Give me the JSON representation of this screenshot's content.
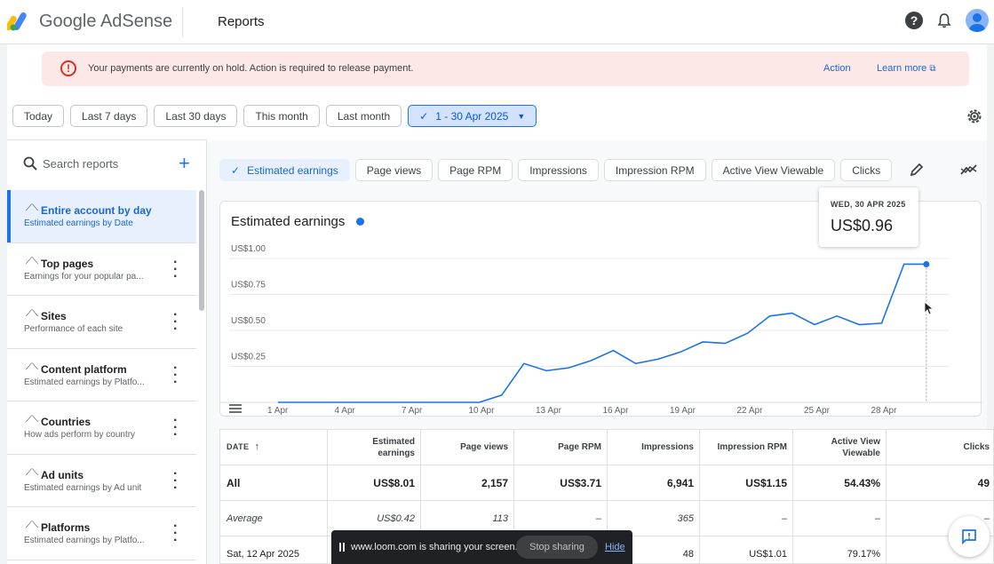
{
  "header": {
    "brand": "Google AdSense",
    "title": "Reports",
    "icons": [
      "help-icon",
      "notifications-icon",
      "account-avatar"
    ]
  },
  "alert": {
    "message": "Your payments are currently on hold. Action is required to release payment.",
    "action_label": "Action",
    "learn_more_label": "Learn more"
  },
  "date_ranges": [
    {
      "label": "Today"
    },
    {
      "label": "Last 7 days"
    },
    {
      "label": "Last 30 days"
    },
    {
      "label": "This month"
    },
    {
      "label": "Last month"
    },
    {
      "label": "1 - 30 Apr 2025",
      "selected": true
    }
  ],
  "sidebar": {
    "search_placeholder": "Search reports",
    "reports": [
      {
        "title": "Entire account by day",
        "subtitle": "Estimated earnings by Date",
        "active": true
      },
      {
        "title": "Top pages",
        "subtitle": "Earnings for your popular pa..."
      },
      {
        "title": "Sites",
        "subtitle": "Performance of each site"
      },
      {
        "title": "Content platform",
        "subtitle": "Estimated earnings by Platfo..."
      },
      {
        "title": "Countries",
        "subtitle": "How ads perform by country"
      },
      {
        "title": "Ad units",
        "subtitle": "Estimated earnings by Ad unit"
      },
      {
        "title": "Platforms",
        "subtitle": "Estimated earnings by Platfo..."
      }
    ]
  },
  "metrics": [
    {
      "label": "Estimated earnings",
      "selected": true
    },
    {
      "label": "Page views"
    },
    {
      "label": "Page RPM"
    },
    {
      "label": "Impressions"
    },
    {
      "label": "Impression RPM"
    },
    {
      "label": "Active View Viewable"
    },
    {
      "label": "Clicks"
    }
  ],
  "tooltip": {
    "date": "WED, 30 APR 2025",
    "value": "US$0.96"
  },
  "chart_data": {
    "type": "line",
    "title": "Estimated earnings",
    "y_ticks": [
      "US$0.25",
      "US$0.50",
      "US$0.75",
      "US$1.00"
    ],
    "ylim": [
      0,
      1.0
    ],
    "x_ticks": [
      "1 Apr",
      "4 Apr",
      "7 Apr",
      "10 Apr",
      "13 Apr",
      "16 Apr",
      "19 Apr",
      "22 Apr",
      "25 Apr",
      "28 Apr"
    ],
    "x": [
      1,
      2,
      3,
      4,
      5,
      6,
      7,
      8,
      9,
      10,
      11,
      12,
      13,
      14,
      15,
      16,
      17,
      18,
      19,
      20,
      21,
      22,
      23,
      24,
      25,
      26,
      27,
      28,
      29,
      30
    ],
    "series": [
      {
        "values": [
          0,
          0,
          0,
          0,
          0,
          0,
          0,
          0,
          0,
          0,
          0.05,
          0.27,
          0.22,
          0.24,
          0.29,
          0.36,
          0.27,
          0.3,
          0.35,
          0.42,
          0.41,
          0.48,
          0.6,
          0.62,
          0.54,
          0.6,
          0.54,
          0.55,
          0.96,
          0.96
        ],
        "color": "#1a73e8"
      }
    ],
    "grid": true,
    "highlight_x": 30
  },
  "table": {
    "columns": [
      "DATE",
      "Estimated earnings",
      "Page views",
      "Page RPM",
      "Impressions",
      "Impression RPM",
      "Active View Viewable",
      "Clicks"
    ],
    "rows": [
      {
        "kind": "all",
        "cells": [
          "All",
          "US$8.01",
          "2,157",
          "US$3.71",
          "6,941",
          "US$1.15",
          "54.43%",
          "49"
        ]
      },
      {
        "kind": "avg",
        "cells": [
          "Average",
          "US$0.42",
          "113",
          "–",
          "365",
          "–",
          "–",
          "–"
        ]
      },
      {
        "kind": "day",
        "cells": [
          "Sat, 12 Apr 2025",
          "",
          "",
          "",
          "48",
          "US$1.01",
          "79.17%",
          ""
        ]
      }
    ]
  },
  "loom": {
    "message": "www.loom.com is sharing your screen.",
    "stop_label": "Stop sharing",
    "hide_label": "Hide"
  }
}
